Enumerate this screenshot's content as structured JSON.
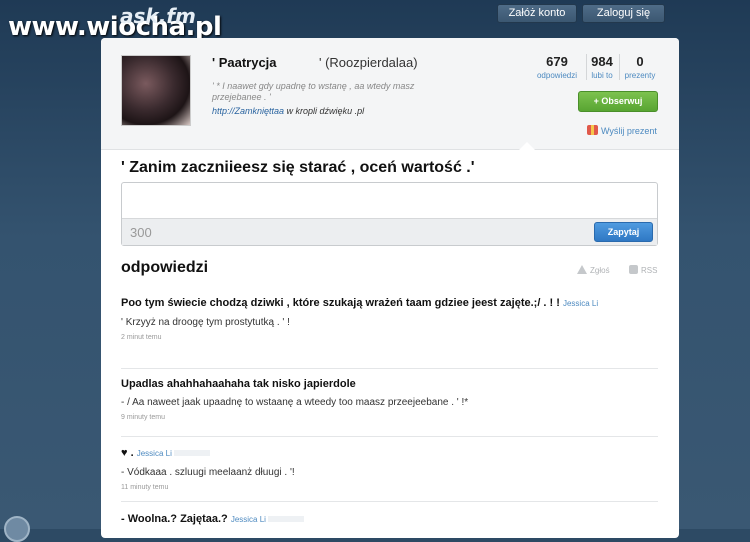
{
  "watermark": "www.wiocha.pl",
  "logo": "ask.fm",
  "top_nav": {
    "signup_label": "Załóż konto",
    "login_label": "Zaloguj się"
  },
  "profile": {
    "name": "' Paatrycja",
    "username": "' (Roozpierdalaa)",
    "bio": "' * I naawet gdy upadnę to wstanę , aa wtedy masz przejebanee . '",
    "link_text": "http://Zamknięttaa",
    "link_suffix": " w kropli dźwięku .pl",
    "stats": [
      {
        "value": "679",
        "label": "odpowiedzi"
      },
      {
        "value": "984",
        "label": "lubi to"
      },
      {
        "value": "0",
        "label": "prezenty"
      }
    ],
    "follow_label": "+ Obserwuj",
    "gift_label": "Wyślij prezent"
  },
  "ask_form": {
    "question_title": "' Zanim zaczniieesz się starać , oceń wartość .'",
    "char_counter": "300",
    "ask_label": "Zapytaj"
  },
  "answers_section": {
    "heading": "odpowiedzi",
    "report_label": "Zgłoś",
    "rss_label": "RSS"
  },
  "answers": [
    {
      "question": "Poo tym świecie chodzą dziwki , które szukają wrażeń taam gdziee jeest zajęte.;/ . ! !",
      "asker": "Jessica Li",
      "answer": "' Krzyyż na droogę tym prostytutką . ' !",
      "time": "2 minut temu"
    },
    {
      "question": "Upadlas ahahhahaahaha tak nisko japierdole",
      "asker": "",
      "answer": "- / Aa naweet jaak upaadnę to wstaanę a wteedy too maasz przeejeebane . ' !*",
      "time": "9 minuty temu"
    },
    {
      "question": "♥ .",
      "asker": "Jessica Li",
      "answer": "- Vódkaaa . szluugi meelaanż dłuugi . '!",
      "time": "11 minuty temu"
    },
    {
      "question": "- Woolna.? Zajętaa.?",
      "asker": "Jessica Li",
      "answer": "",
      "time": ""
    }
  ],
  "colors": {
    "background": "#2d4a64",
    "accent_blue": "#4d8ac0",
    "follow_green": "#58a532",
    "ask_button_blue": "#2f78c4"
  }
}
